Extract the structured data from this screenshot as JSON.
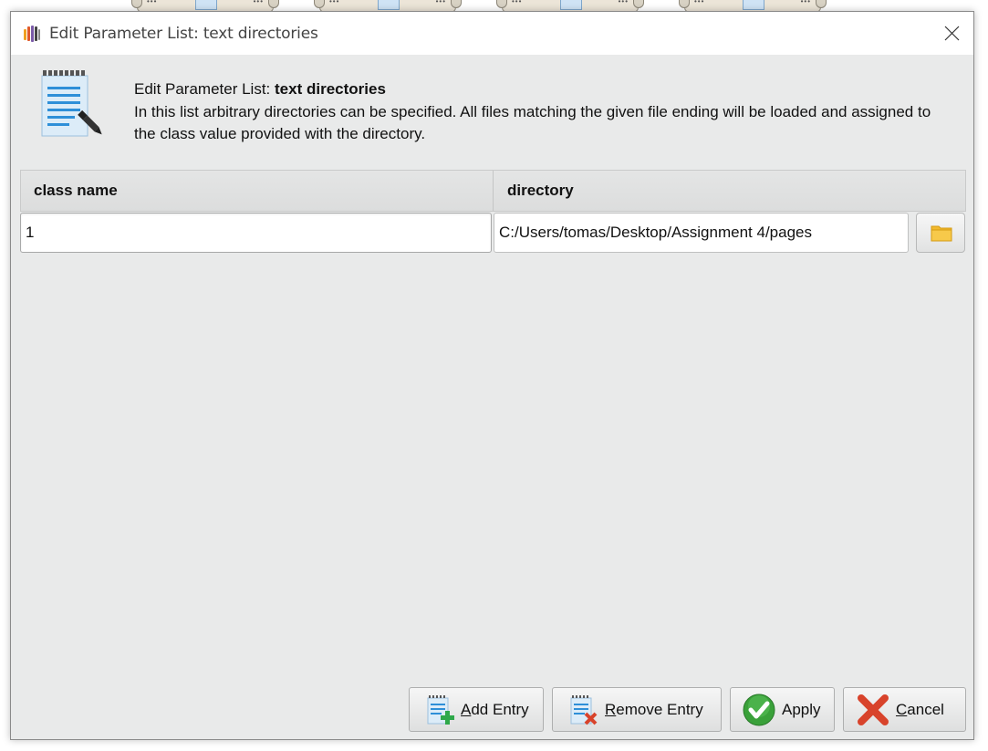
{
  "window": {
    "title": "Edit Parameter List: text directories"
  },
  "header": {
    "title_prefix": "Edit Parameter List: ",
    "title_bold": "text directories",
    "description": "In this list arbitrary directories can be specified. All files matching the given file ending will be loaded and assigned to the class value provided with the directory."
  },
  "table": {
    "columns": [
      "class name",
      "directory"
    ],
    "rows": [
      {
        "class_name": "1",
        "directory": "C:/Users/tomas/Desktop/Assignment 4/pages"
      }
    ]
  },
  "buttons": {
    "add": "Add Entry",
    "remove": "Remove Entry",
    "apply": "Apply",
    "cancel": "Cancel"
  },
  "icons": {
    "app": "rapidminer-logo-icon",
    "header": "edit-list-icon",
    "close": "close-icon",
    "browse": "folder-icon",
    "add": "add-entry-icon",
    "remove": "remove-entry-icon",
    "apply": "checkmark-icon",
    "cancel": "cancel-x-icon"
  },
  "colors": {
    "dialog_bg": "#e9eaea",
    "apply_green": "#3aa13a",
    "cancel_red": "#d8432b",
    "folder_yellow": "#f2b92c"
  }
}
